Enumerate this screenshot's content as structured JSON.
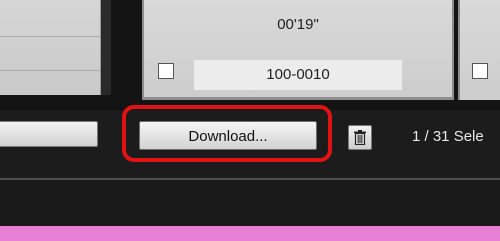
{
  "thumbnail": {
    "duration": "00'19\"",
    "filename": "100-0010"
  },
  "toolbar": {
    "download_label": "Download...",
    "trash_icon": "trash-icon",
    "selection_status": "1 / 31 Sele"
  },
  "colors": {
    "highlight": "#e01212",
    "bottom_bar": "#e880d4",
    "background": "#1c1c1c"
  }
}
